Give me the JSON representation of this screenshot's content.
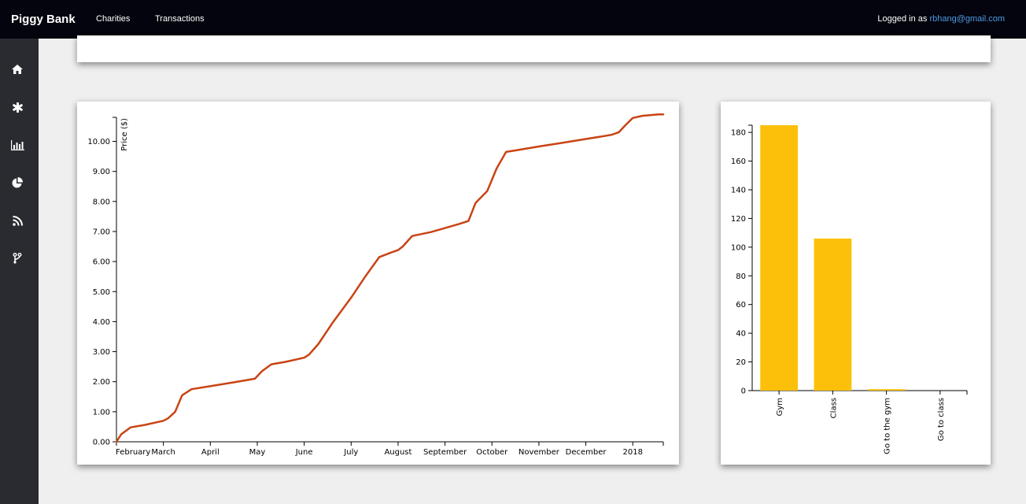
{
  "header": {
    "brand": "Piggy Bank",
    "nav": [
      {
        "label": "Charities"
      },
      {
        "label": "Transactions"
      }
    ],
    "login_prefix": "Logged in as",
    "login_email": "rbhang@gmail.com"
  },
  "sidebar": {
    "items": [
      {
        "icon": "home-icon"
      },
      {
        "icon": "asterisk-icon"
      },
      {
        "icon": "bar-chart-icon"
      },
      {
        "icon": "pie-chart-icon"
      },
      {
        "icon": "rss-icon"
      },
      {
        "icon": "branch-icon"
      }
    ]
  },
  "colors": {
    "topbar": "#03040d",
    "sidebar": "#2a2b30",
    "line": "#c84414",
    "bar": "#fcc00a",
    "email": "#4e9be6"
  },
  "chart_data": [
    {
      "type": "line",
      "title": "",
      "xlabel": "",
      "ylabel": "Price ($)",
      "x_ticks": [
        "February",
        "March",
        "April",
        "May",
        "June",
        "July",
        "August",
        "September",
        "October",
        "November",
        "December",
        "2018"
      ],
      "y_ticks": [
        "0.00",
        "1.00",
        "2.00",
        "3.00",
        "4.00",
        "5.00",
        "6.00",
        "7.00",
        "8.00",
        "9.00",
        "10.00"
      ],
      "ylim": [
        0,
        10.8
      ],
      "x_unit": "month",
      "xlim": [
        0,
        11.65
      ],
      "series": [
        {
          "x": [
            0.0,
            0.1,
            0.3,
            0.6,
            1.0,
            1.1,
            1.25,
            1.4,
            1.6,
            2.0,
            2.5,
            2.95,
            3.1,
            3.3,
            3.6,
            4.0,
            4.1,
            4.3,
            4.6,
            5.0,
            5.3,
            5.6,
            5.85,
            6.0,
            6.1,
            6.3,
            6.7,
            7.3,
            7.5,
            7.65,
            7.9,
            8.1,
            8.3,
            8.5,
            9.0,
            9.5,
            10.0,
            10.4,
            10.55,
            10.7,
            10.85,
            11.0,
            11.2,
            11.55,
            11.65
          ],
          "y": [
            0.0,
            0.25,
            0.48,
            0.56,
            0.7,
            0.78,
            1.0,
            1.55,
            1.75,
            1.85,
            1.98,
            2.1,
            2.35,
            2.58,
            2.66,
            2.8,
            2.9,
            3.25,
            3.95,
            4.8,
            5.5,
            6.15,
            6.3,
            6.38,
            6.5,
            6.85,
            6.98,
            7.25,
            7.35,
            7.95,
            8.35,
            9.1,
            9.65,
            9.7,
            9.83,
            9.95,
            10.08,
            10.18,
            10.22,
            10.3,
            10.55,
            10.78,
            10.85,
            10.9,
            10.9
          ]
        }
      ]
    },
    {
      "type": "bar",
      "title": "",
      "xlabel": "",
      "ylabel": "",
      "categories": [
        "Gym",
        "Class",
        "Go to the gym",
        "Go to class"
      ],
      "values": [
        185,
        106,
        1,
        0
      ],
      "y_ticks": [
        "0",
        "20",
        "40",
        "60",
        "80",
        "100",
        "120",
        "140",
        "160",
        "180"
      ],
      "ylim": [
        0,
        185
      ]
    }
  ]
}
